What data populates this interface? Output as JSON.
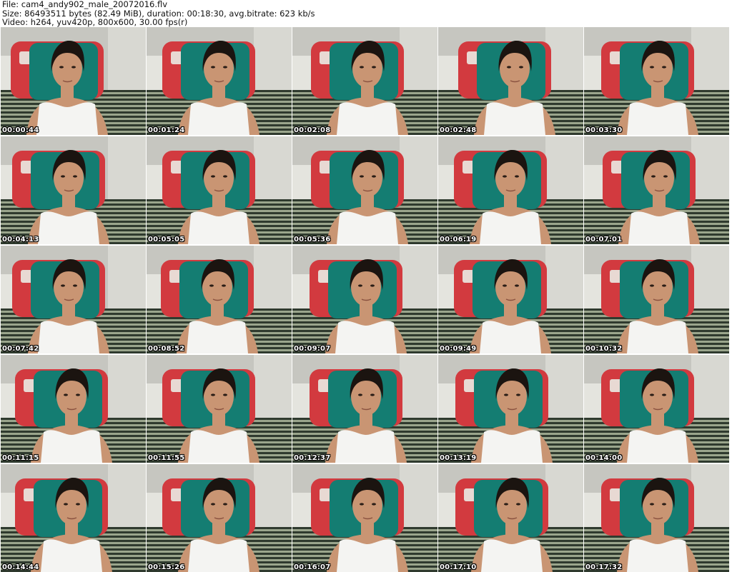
{
  "header": {
    "file_line": "File: cam4_andy902_male_20072016.flv",
    "size_line": "Size: 86493511 bytes (82.49 MiB), duration: 00:18:30, avg.bitrate: 623 kb/s",
    "video_line": "Video: h264, yuv420p, 800x600, 30.00 fps(r)"
  },
  "thumbnails": [
    {
      "timestamp": "00:00:44"
    },
    {
      "timestamp": "00:01:24"
    },
    {
      "timestamp": "00:02:08"
    },
    {
      "timestamp": "00:02:48"
    },
    {
      "timestamp": "00:03:30"
    },
    {
      "timestamp": "00:04:13"
    },
    {
      "timestamp": "00:05:05"
    },
    {
      "timestamp": "00:05:36"
    },
    {
      "timestamp": "00:06:19"
    },
    {
      "timestamp": "00:07:01"
    },
    {
      "timestamp": "00:07:42"
    },
    {
      "timestamp": "00:08:52"
    },
    {
      "timestamp": "00:09:07"
    },
    {
      "timestamp": "00:09:49"
    },
    {
      "timestamp": "00:10:32"
    },
    {
      "timestamp": "00:11:15"
    },
    {
      "timestamp": "00:11:55"
    },
    {
      "timestamp": "00:12:37"
    },
    {
      "timestamp": "00:13:19"
    },
    {
      "timestamp": "00:14:00"
    },
    {
      "timestamp": "00:14:44"
    },
    {
      "timestamp": "00:15:26"
    },
    {
      "timestamp": "00:16:07"
    },
    {
      "timestamp": "00:17:10"
    },
    {
      "timestamp": "00:17:32"
    }
  ],
  "colors": {
    "wall": "#c6c6c0",
    "red_cushion": "#d23a3f",
    "teal_cushion": "#147d72",
    "stripe_dark": "#2f3a2e",
    "stripe_light": "#9aa58c",
    "shirt": "#f4f4f2",
    "skin": "#c99573",
    "hair": "#1b1410"
  }
}
